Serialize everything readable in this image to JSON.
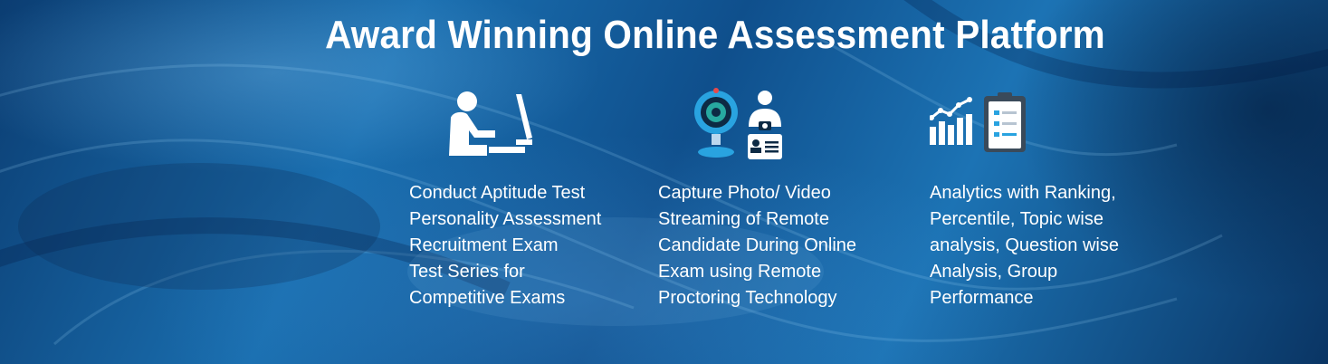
{
  "banner": {
    "title": "Award Winning Online Assessment Platform",
    "features": [
      {
        "icon": "person-at-computer-icon",
        "lines": [
          "Conduct Aptitude Test",
          "Personality Assessment",
          "Recruitment Exam",
          "Test Series for",
          "Competitive Exams"
        ]
      },
      {
        "icon": "webcam-and-id-card-icon",
        "lines": [
          "Capture Photo/ Video",
          "Streaming of Remote",
          "Candidate During Online",
          "Exam using Remote",
          "Proctoring Technology"
        ]
      },
      {
        "icon": "analytics-chart-and-clipboard-icon",
        "lines": [
          "Analytics with Ranking,",
          "Percentile, Topic wise",
          "analysis, Question wise",
          "Analysis, Group",
          "Performance"
        ]
      }
    ]
  },
  "colors": {
    "background_dark": "#0b3d72",
    "background_light": "#1a6fb0",
    "text": "#ffffff",
    "icon_accent": "#29a3e0"
  }
}
